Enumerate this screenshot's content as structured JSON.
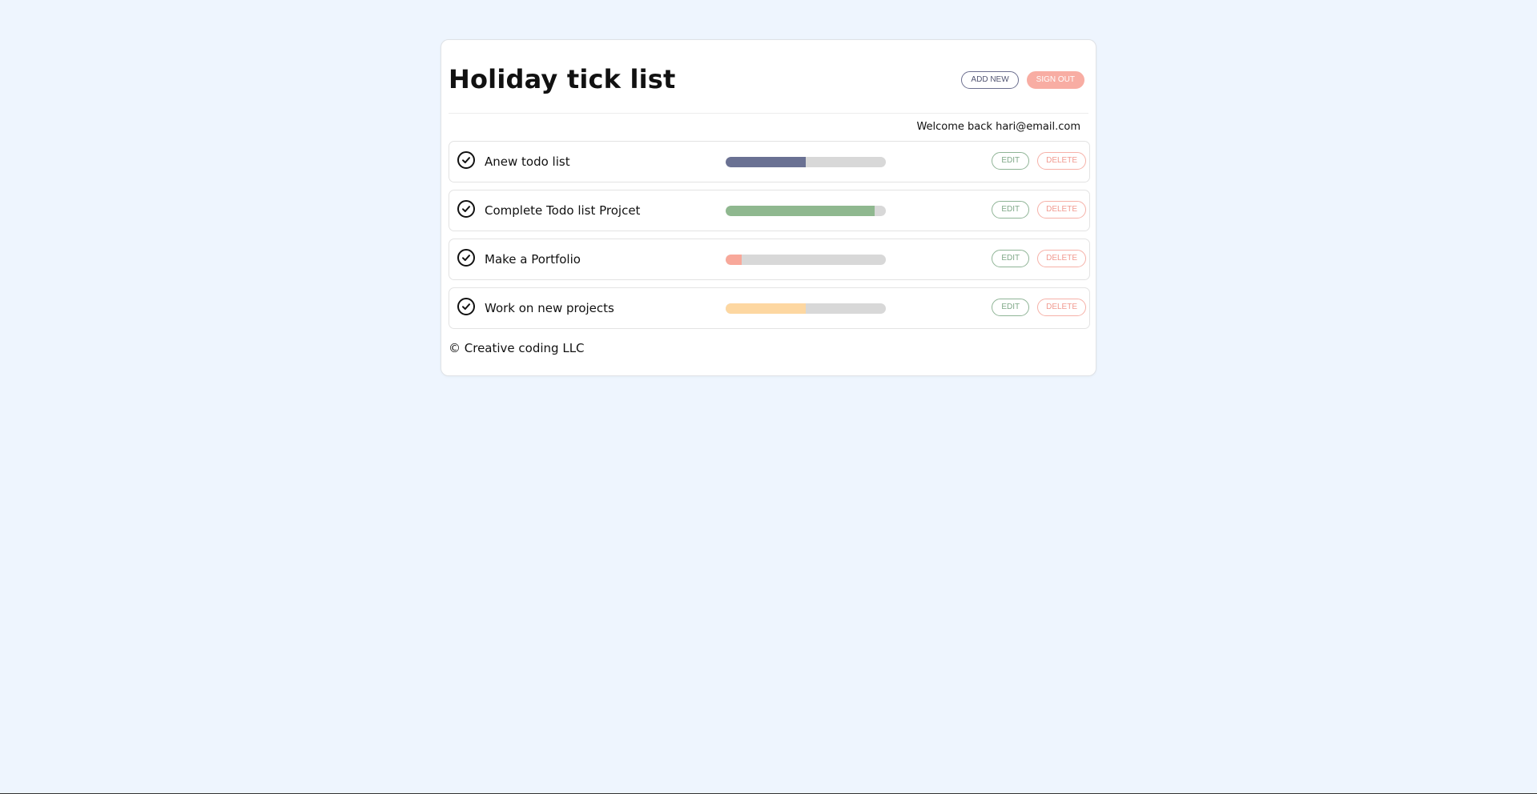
{
  "app": {
    "title": "Holiday tick list",
    "add_new_label": "ADD NEW",
    "sign_out_label": "SIGN OUT",
    "welcome_text": "Welcome back hari@email.com",
    "footer_text": "© Creative coding LLC"
  },
  "items": [
    {
      "label": "Anew todo list",
      "progress": 0.5,
      "color": "#6a7193",
      "edit_label": "EDIT",
      "delete_label": "DELETE"
    },
    {
      "label": "Complete Todo list Projcet",
      "progress": 0.93,
      "color": "#8fb88f",
      "edit_label": "EDIT",
      "delete_label": "DELETE"
    },
    {
      "label": "Make a Portfolio",
      "progress": 0.1,
      "color": "#f8a89a",
      "edit_label": "EDIT",
      "delete_label": "DELETE"
    },
    {
      "label": "Work on new projects",
      "progress": 0.5,
      "color": "#fdd7a1",
      "edit_label": "EDIT",
      "delete_label": "DELETE"
    }
  ],
  "colors": {
    "background": "#eef5fe",
    "card": "#ffffff",
    "accent_sign_out": "#f8ada3",
    "edit": "#8fb496",
    "delete": "#f6b1a8"
  },
  "icons": {
    "item_status": "check-circle-icon"
  }
}
